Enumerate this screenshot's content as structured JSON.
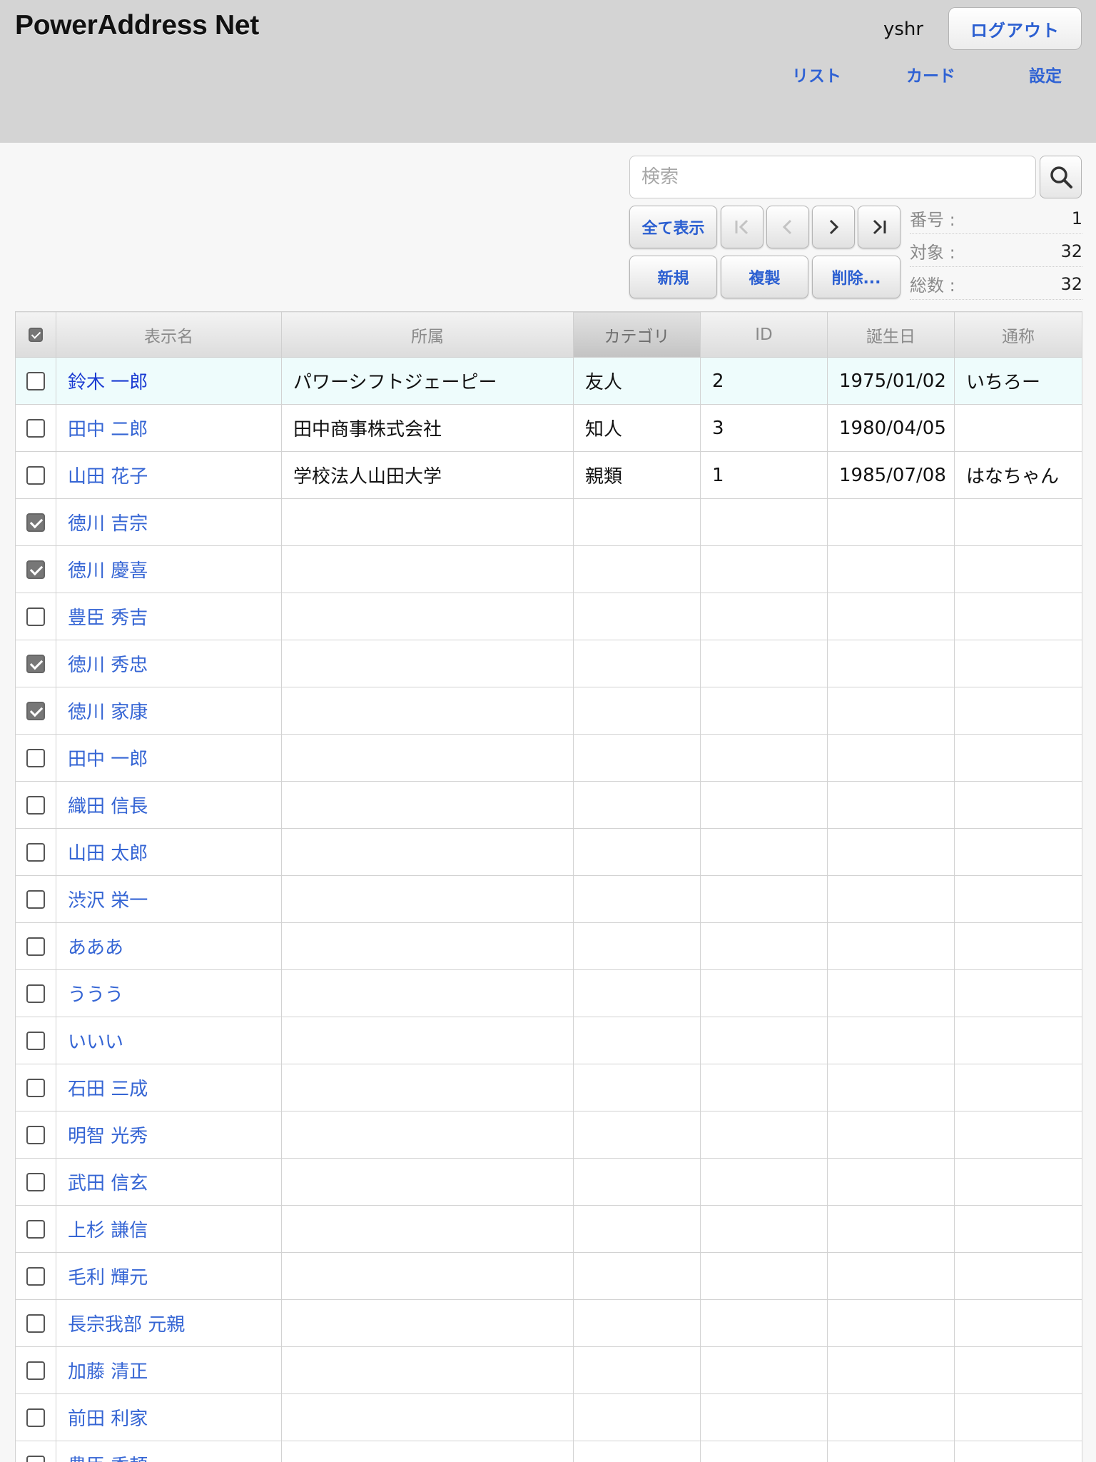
{
  "app": {
    "title": "PowerAddress Net"
  },
  "header": {
    "username": "yshr",
    "logout_label": "ログアウト",
    "nav": [
      "リスト",
      "カード",
      "設定"
    ]
  },
  "search": {
    "placeholder": "検索",
    "value": ""
  },
  "toolbar": {
    "show_all_label": "全て表示",
    "new_label": "新規",
    "duplicate_label": "複製",
    "delete_label": "削除..."
  },
  "record_info": [
    {
      "label": "番号 :",
      "value": "1"
    },
    {
      "label": "対象 :",
      "value": "32"
    },
    {
      "label": "総数 :",
      "value": "32"
    }
  ],
  "table": {
    "columns": [
      "表示名",
      "所属",
      "カテゴリ",
      "ID",
      "誕生日",
      "通称"
    ],
    "sorted_column": "カテゴリ",
    "rows": [
      {
        "checked": false,
        "selected": true,
        "cells": [
          "鈴木 一郎",
          "パワーシフトジェーピー",
          "友人",
          "2",
          "1975/01/02",
          "いちろー"
        ]
      },
      {
        "checked": false,
        "selected": false,
        "cells": [
          "田中 二郎",
          "田中商事株式会社",
          "知人",
          "3",
          "1980/04/05",
          ""
        ]
      },
      {
        "checked": false,
        "selected": false,
        "cells": [
          "山田 花子",
          "学校法人山田大学",
          "親類",
          "1",
          "1985/07/08",
          "はなちゃん"
        ]
      },
      {
        "checked": true,
        "selected": false,
        "cells": [
          "徳川 吉宗",
          "",
          "",
          "",
          "",
          ""
        ]
      },
      {
        "checked": true,
        "selected": false,
        "cells": [
          "徳川 慶喜",
          "",
          "",
          "",
          "",
          ""
        ]
      },
      {
        "checked": false,
        "selected": false,
        "cells": [
          "豊臣 秀吉",
          "",
          "",
          "",
          "",
          ""
        ]
      },
      {
        "checked": true,
        "selected": false,
        "cells": [
          "徳川 秀忠",
          "",
          "",
          "",
          "",
          ""
        ]
      },
      {
        "checked": true,
        "selected": false,
        "cells": [
          "徳川 家康",
          "",
          "",
          "",
          "",
          ""
        ]
      },
      {
        "checked": false,
        "selected": false,
        "cells": [
          "田中 一郎",
          "",
          "",
          "",
          "",
          ""
        ]
      },
      {
        "checked": false,
        "selected": false,
        "cells": [
          "織田 信長",
          "",
          "",
          "",
          "",
          ""
        ]
      },
      {
        "checked": false,
        "selected": false,
        "cells": [
          "山田 太郎",
          "",
          "",
          "",
          "",
          ""
        ]
      },
      {
        "checked": false,
        "selected": false,
        "cells": [
          "渋沢 栄一",
          "",
          "",
          "",
          "",
          ""
        ]
      },
      {
        "checked": false,
        "selected": false,
        "cells": [
          "あああ",
          "",
          "",
          "",
          "",
          ""
        ]
      },
      {
        "checked": false,
        "selected": false,
        "cells": [
          "ううう",
          "",
          "",
          "",
          "",
          ""
        ]
      },
      {
        "checked": false,
        "selected": false,
        "cells": [
          "いいい",
          "",
          "",
          "",
          "",
          ""
        ]
      },
      {
        "checked": false,
        "selected": false,
        "cells": [
          "石田 三成",
          "",
          "",
          "",
          "",
          ""
        ]
      },
      {
        "checked": false,
        "selected": false,
        "cells": [
          "明智 光秀",
          "",
          "",
          "",
          "",
          ""
        ]
      },
      {
        "checked": false,
        "selected": false,
        "cells": [
          "武田 信玄",
          "",
          "",
          "",
          "",
          ""
        ]
      },
      {
        "checked": false,
        "selected": false,
        "cells": [
          "上杉 謙信",
          "",
          "",
          "",
          "",
          ""
        ]
      },
      {
        "checked": false,
        "selected": false,
        "cells": [
          "毛利 輝元",
          "",
          "",
          "",
          "",
          ""
        ]
      },
      {
        "checked": false,
        "selected": false,
        "cells": [
          "長宗我部 元親",
          "",
          "",
          "",
          "",
          ""
        ]
      },
      {
        "checked": false,
        "selected": false,
        "cells": [
          "加藤 清正",
          "",
          "",
          "",
          "",
          ""
        ]
      },
      {
        "checked": false,
        "selected": false,
        "cells": [
          "前田 利家",
          "",
          "",
          "",
          "",
          ""
        ]
      },
      {
        "checked": false,
        "selected": false,
        "cells": [
          "豊臣 秀頼",
          "",
          "",
          "",
          "",
          ""
        ]
      }
    ]
  },
  "colors": {
    "header_bg": "#d4d4d4",
    "link": "#3565d4",
    "selected_row": "#eefcfc"
  }
}
